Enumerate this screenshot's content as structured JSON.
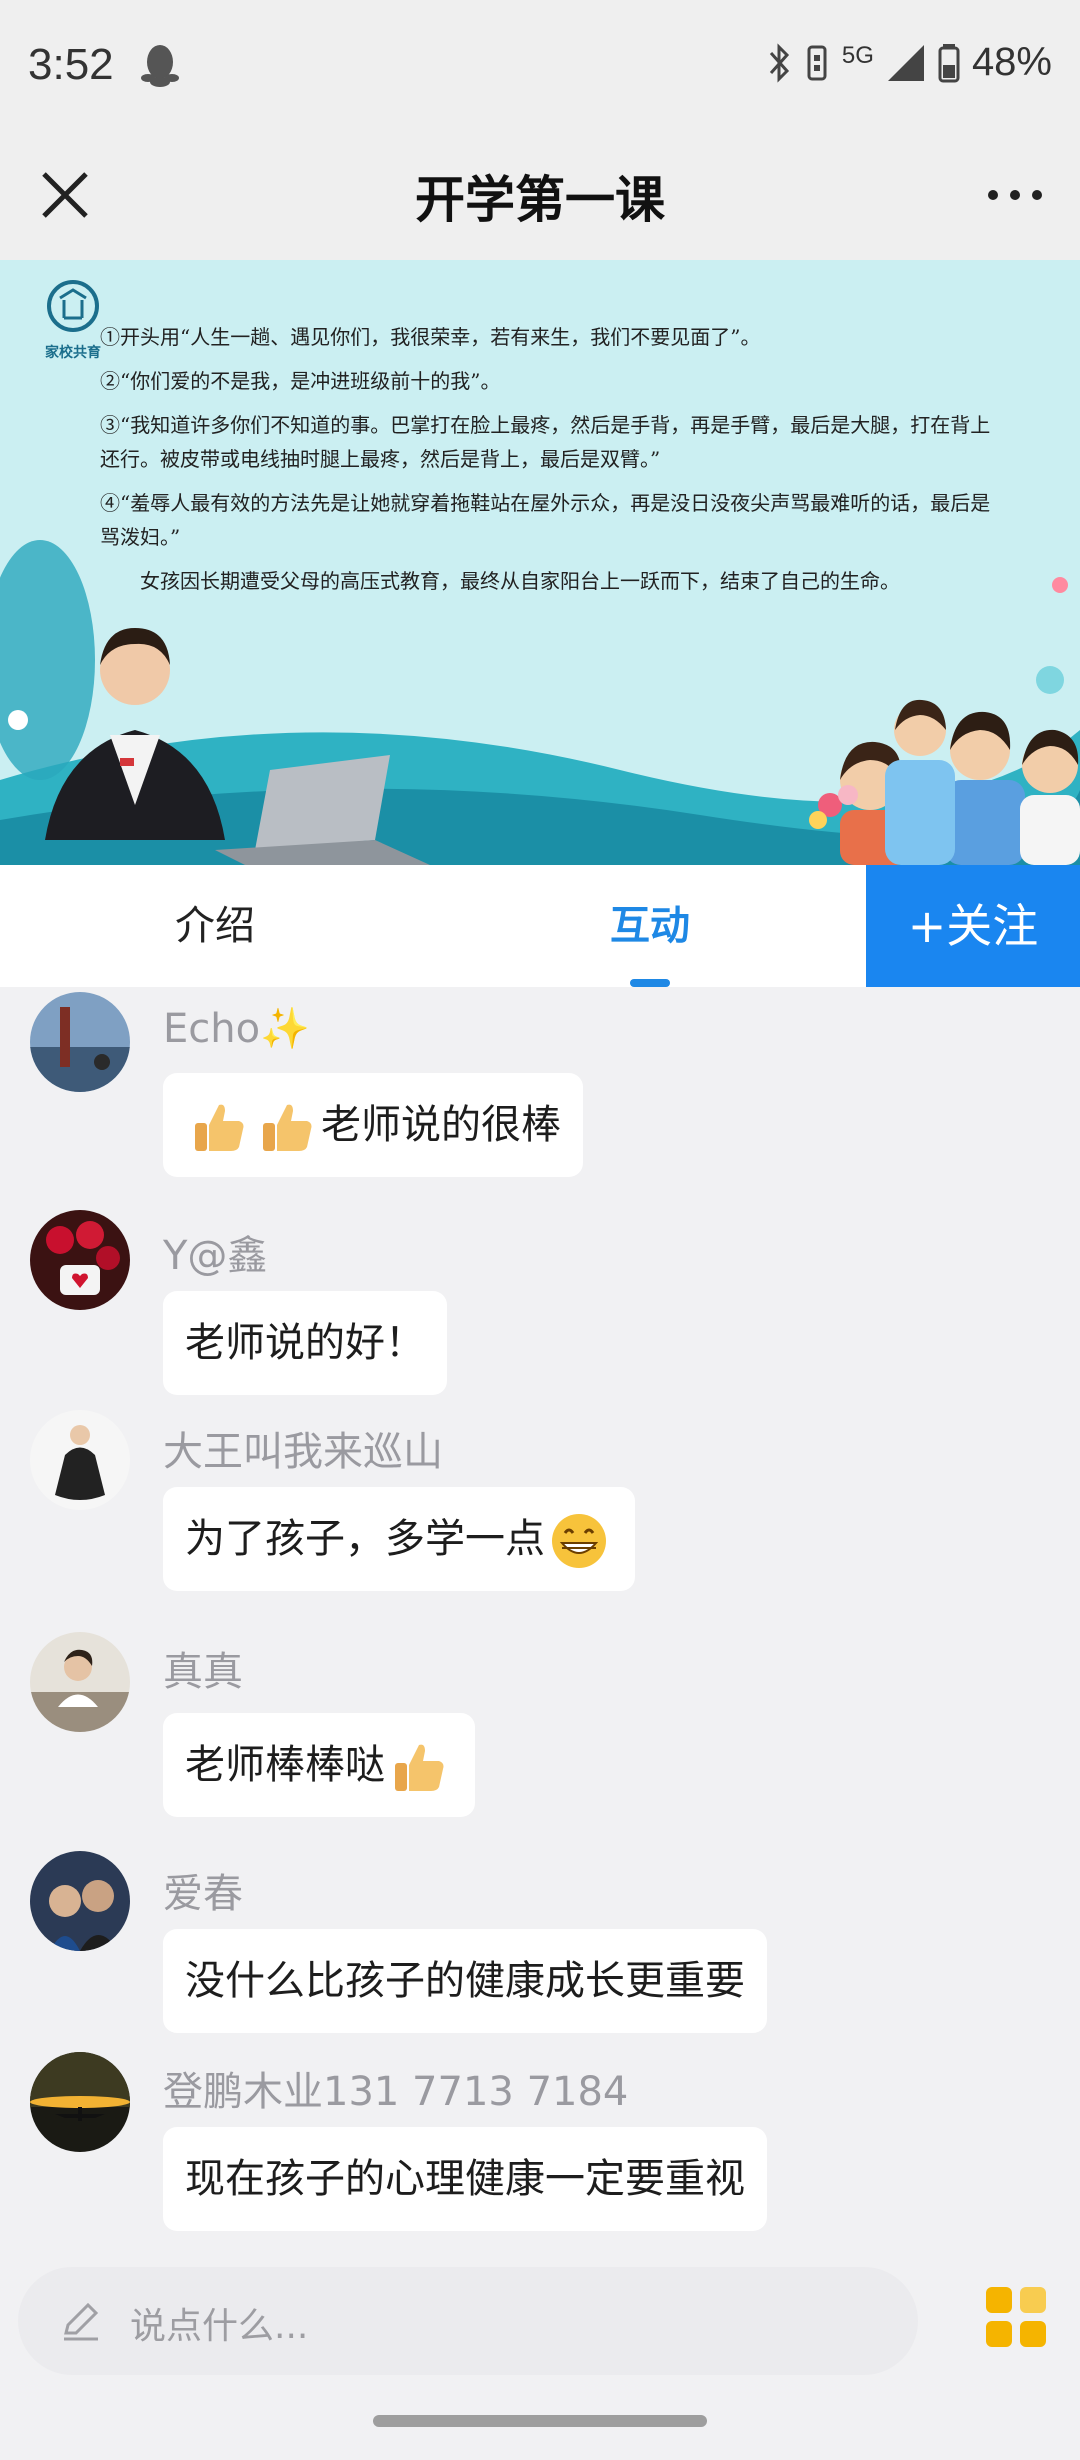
{
  "status_bar": {
    "time": "3:52",
    "network": "5G",
    "battery": "48%"
  },
  "header": {
    "title": "开学第一课"
  },
  "video": {
    "logo_text": "家校共育",
    "lines": [
      "①开头用“人生一趟、遇见你们，我很荣幸，若有来生，我们不要见面了”。",
      "②“你们爱的不是我，是冲进班级前十的我”。",
      "③“我知道许多你们不知道的事。巴掌打在脸上最疼，然后是手背，再是手臂，最后是大腿，打在背上还行。被皮带或电线抽时腿上最疼，然后是背上，最后是双臂。”",
      "④“羞辱人最有效的方法先是让她就穿着拖鞋站在屋外示众，再是没日没夜尖声骂最难听的话，最后是骂泼妇。”",
      "女孩因长期遭受父母的高压式教育，最终从自家阳台上一跃而下，结束了自己的生命。"
    ]
  },
  "tabs": {
    "intro": "介绍",
    "interact": "互动",
    "follow": "+关注"
  },
  "messages": [
    {
      "user": "Echo✨",
      "text": "老师说的很棒",
      "prefix_emoji": "thumbs-up-icon"
    },
    {
      "user": "Y@鑫",
      "text": "老师说的好！"
    },
    {
      "user": "大王叫我来巡山",
      "text": "为了孩子，多学一点",
      "suffix_emoji": "grinning-face-icon"
    },
    {
      "user": "真真",
      "text": "老师棒棒哒",
      "suffix_emoji": "thumbs-up-icon"
    },
    {
      "user": "爱春",
      "text": "没什么比孩子的健康成长更重要"
    },
    {
      "user": "登鹏木业131 7713 7184",
      "text": "现在孩子的心理健康一定要重视"
    }
  ],
  "input": {
    "placeholder": "说点什么..."
  },
  "colors": {
    "accent": "#1e88e5",
    "follow_bg": "#1a86f0",
    "page_bg": "#f1f1f3",
    "apps_icon": "#f5b400"
  }
}
